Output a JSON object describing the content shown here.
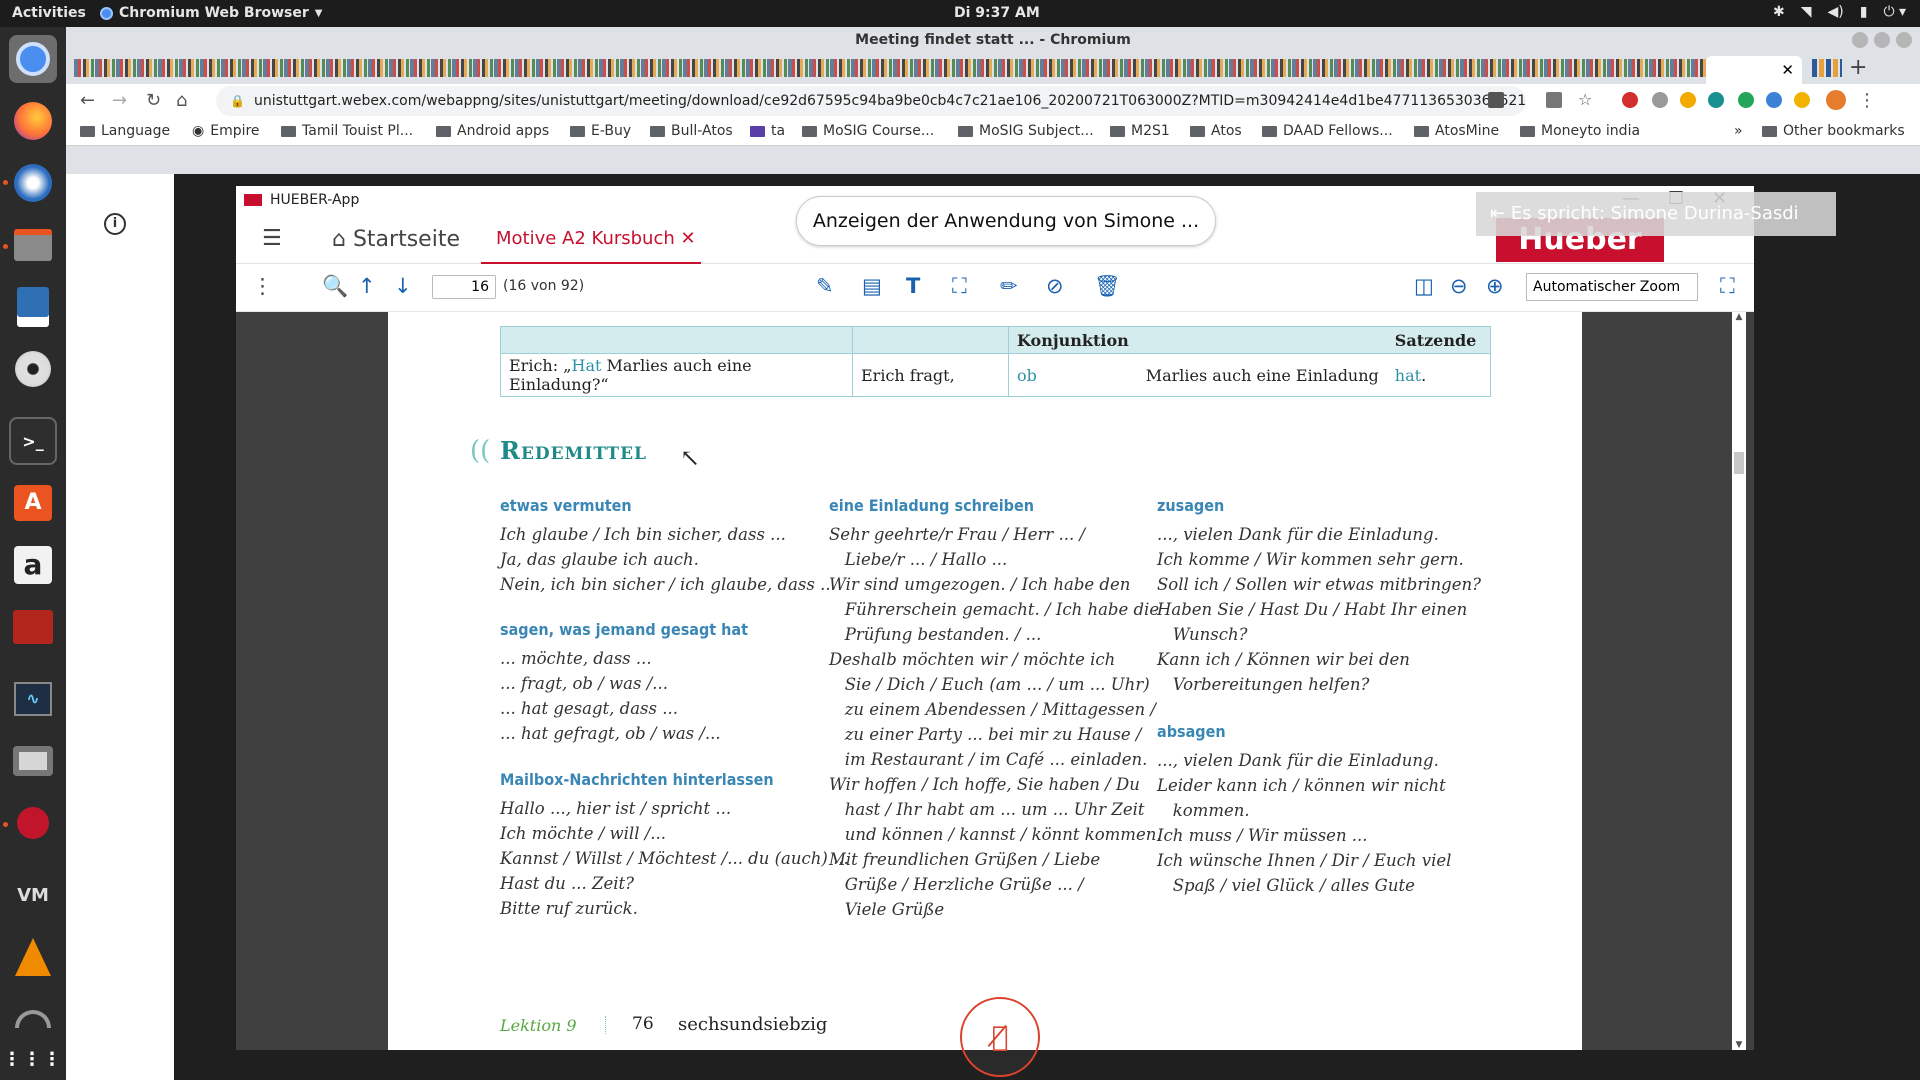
{
  "topbar": {
    "activities": "Activities",
    "app": "Chromium Web Browser",
    "clock": "Di  9:37 AM",
    "tray": [
      "bluetooth",
      "wifi",
      "volume",
      "battery",
      "power"
    ]
  },
  "dock": [
    "chromium-icon",
    "firefox-icon",
    "thunderbird-icon",
    "files-icon",
    "text-editor-icon",
    "rhythmbox-icon",
    "terminal-icon",
    "software-icon",
    "amazon-icon",
    "app-icon",
    "system-monitor-icon",
    "camera-icon",
    "cherry-icon",
    "vm-icon",
    "vlc-icon",
    "update-icon",
    "apps-grid-icon"
  ],
  "browser": {
    "window_title": "Meeting findet statt ... - Chromium",
    "url": "unistuttgart.webex.com/webappng/sites/unistuttgart/meeting/download/ce92d67595c94ba9be0cb4c7c21ae106_20200721T063000Z?MTID=m30942414e4d1be477113653036162165&launchApp...",
    "bookmarks": [
      "Language",
      "Empire",
      "Tamil Touist Pl...",
      "Android apps",
      "E-Buy",
      "Bull-Atos",
      "ta",
      "MoSIG Course...",
      "MoSIG Subject...",
      "M2S1",
      "Atos",
      "DAAD Fellows...",
      "AtosMine",
      "Moneyto india"
    ],
    "other_bookmarks": "Other bookmarks",
    "more": "»"
  },
  "app": {
    "title": "HUEBER-App",
    "share_banner": "Anzeigen der Anwendung von Simone ...",
    "home": "Startseite",
    "book_tab": "Motive A2 Kursbuch",
    "logo": "Hueber",
    "speaker": "Es spricht: Simone Durina-Sasdi",
    "page": "16",
    "page_count": "(16 von 92)",
    "zoom": "Automatischer Zoom"
  },
  "pdf": {
    "table": {
      "headers": [
        "",
        "",
        "Konjunktion",
        "",
        "Satzende"
      ],
      "row": {
        "quote_pre": "Erich: „",
        "quote_verb": "Hat",
        "quote_post": " Marlies auch eine Einladung?“",
        "erich": "Erich fragt,",
        "konj": "ob",
        "mid": "Marlies auch eine Einladung",
        "end": "hat",
        "dot": "."
      }
    },
    "heading": "Redemittel",
    "col1": {
      "h1": "etwas vermuten",
      "l1": [
        "Ich glaube / Ich bin sicher, dass ...",
        "Ja, das glaube ich auch.",
        "Nein, ich bin sicher / ich glaube, dass ..."
      ],
      "h2": "sagen, was jemand gesagt hat",
      "l2": [
        "... möchte, dass ...",
        "... fragt, ob / was /...",
        "... hat gesagt, dass ...",
        "... hat gefragt, ob / was /..."
      ],
      "h3": "Mailbox-Nachrichten hinterlassen",
      "l3": [
        "Hallo ..., hier ist / spricht ...",
        "Ich möchte / will /...",
        "Kannst / Willst / Möchtest /... du (auch) ...",
        "Hast du ... Zeit?",
        "Bitte ruf zurück."
      ]
    },
    "col2": {
      "h1": "eine Einladung schreiben",
      "l1": [
        "Sehr geehrte/r Frau / Herr ... /",
        "   Liebe/r ... / Hallo ...",
        "Wir sind umgezogen. / Ich habe den",
        "   Führerschein gemacht. / Ich habe die",
        "   Prüfung bestanden. / ...",
        "Deshalb möchten wir / möchte ich",
        "   Sie / Dich / Euch (am ... / um ... Uhr)",
        "   zu einem Abendessen / Mittagessen /",
        "   zu einer Party ... bei mir zu Hause /",
        "   im Restaurant / im Café ... einladen.",
        "Wir hoffen / Ich hoffe, Sie haben / Du",
        "   hast / Ihr habt am ... um ... Uhr Zeit",
        "   und können / kannst / könnt kommen.",
        "Mit freundlichen Grüßen / Liebe",
        "   Grüße / Herzliche Grüße ... /",
        "   Viele Grüße"
      ]
    },
    "col3": {
      "h1": "zusagen",
      "l1": [
        "..., vielen Dank für die Einladung.",
        "Ich komme / Wir kommen sehr gern.",
        "Soll ich / Sollen wir etwas mitbringen?",
        "Haben Sie / Hast Du / Habt Ihr einen",
        "   Wunsch?",
        "Kann ich / Können wir bei den",
        "   Vorbereitungen helfen?"
      ],
      "h2": "absagen",
      "l2": [
        "..., vielen Dank für die Einladung.",
        "Leider kann ich / können wir nicht",
        "   kommen.",
        "Ich muss / Wir müssen ...",
        "Ich wünsche Ihnen / Dir / Euch viel",
        "   Spaß / viel Glück / alles Gute"
      ]
    },
    "footer": {
      "lesson": "Lektion 9",
      "page": "76",
      "word": "sechsundsiebzig"
    }
  }
}
